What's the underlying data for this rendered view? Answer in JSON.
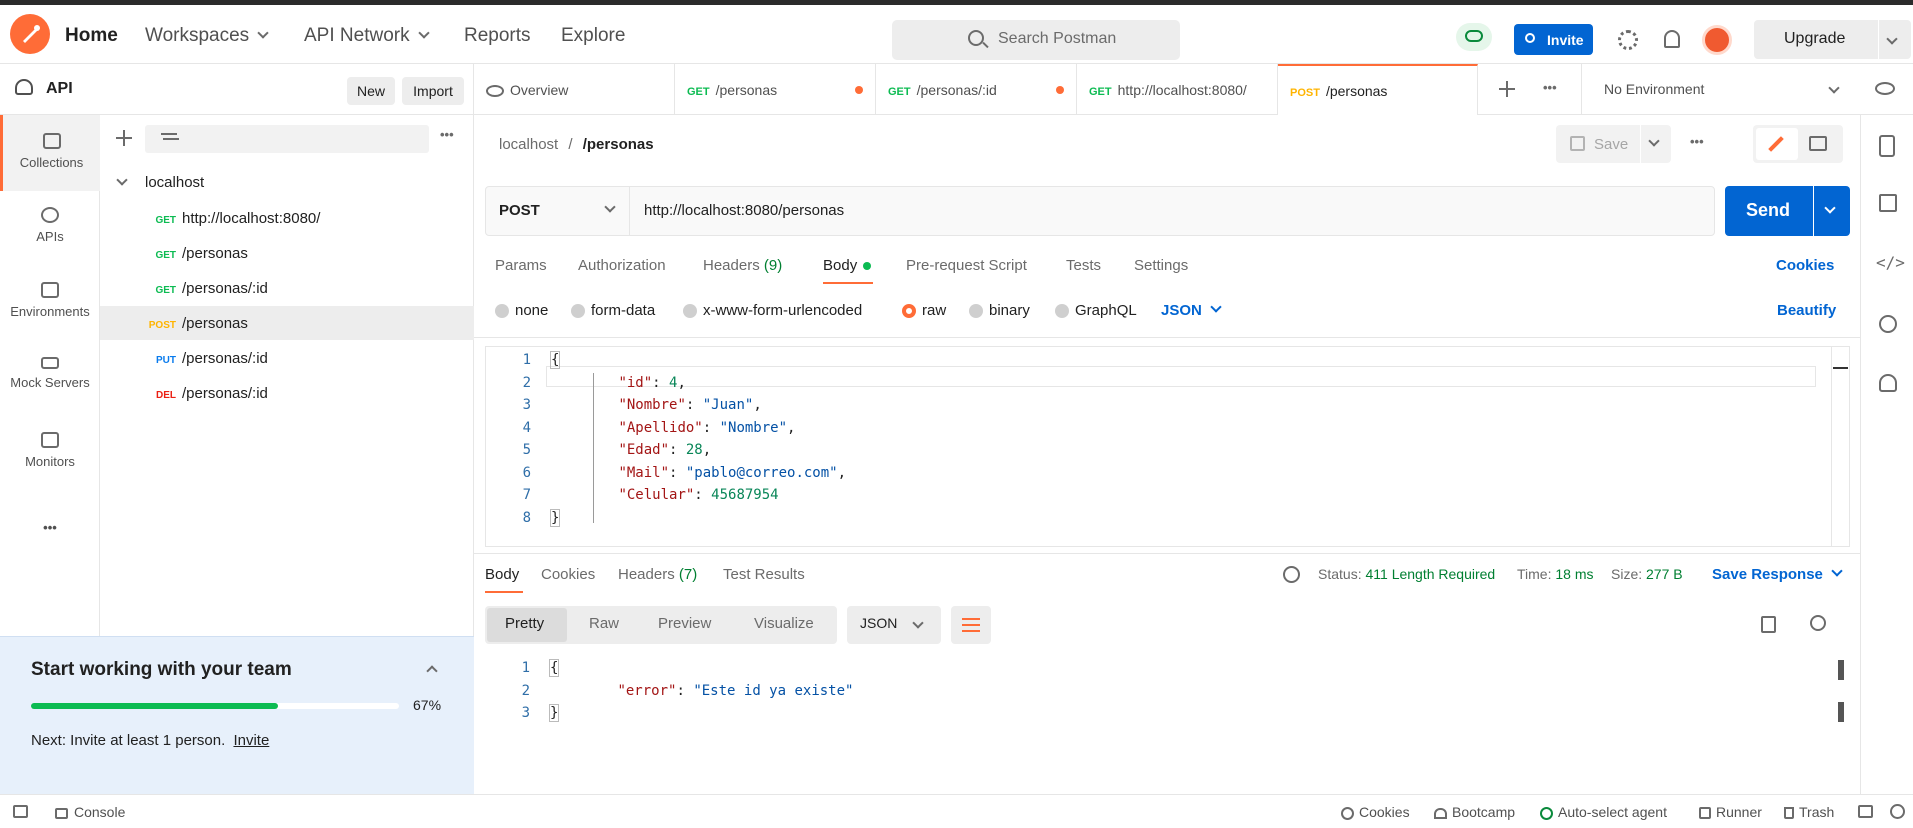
{
  "topnav": {
    "home": "Home",
    "workspaces": "Workspaces",
    "api_network": "API Network",
    "reports": "Reports",
    "explore": "Explore",
    "search_placeholder": "Search Postman",
    "invite": "Invite",
    "upgrade": "Upgrade"
  },
  "workspace": {
    "name": "API",
    "new_label": "New",
    "import_label": "Import"
  },
  "sidebar": {
    "items": [
      {
        "label": "Collections",
        "icon": "collections-icon"
      },
      {
        "label": "APIs",
        "icon": "apis-icon"
      },
      {
        "label": "Environments",
        "icon": "environments-icon"
      },
      {
        "label": "Mock Servers",
        "icon": "mock-servers-icon"
      },
      {
        "label": "Monitors",
        "icon": "monitors-icon"
      }
    ],
    "more": "•••"
  },
  "collection": {
    "name": "localhost",
    "requests": [
      {
        "method": "GET",
        "name": "http://localhost:8080/"
      },
      {
        "method": "GET",
        "name": "/personas"
      },
      {
        "method": "GET",
        "name": "/personas/:id"
      },
      {
        "method": "POST",
        "name": "/personas"
      },
      {
        "method": "PUT",
        "name": "/personas/:id"
      },
      {
        "method": "DEL",
        "name": "/personas/:id"
      }
    ]
  },
  "tabs": [
    {
      "method": "",
      "label": "Overview"
    },
    {
      "method": "GET",
      "label": "/personas"
    },
    {
      "method": "GET",
      "label": "/personas/:id"
    },
    {
      "method": "GET",
      "label": "http://localhost:8080/"
    },
    {
      "method": "POST",
      "label": "/personas"
    }
  ],
  "environment": "No Environment",
  "breadcrumb": {
    "parent": "localhost",
    "sep": "/",
    "current": "/personas"
  },
  "save_label": "Save",
  "request": {
    "method": "POST",
    "url": "http://localhost:8080/personas",
    "send": "Send"
  },
  "request_tabs": {
    "params": "Params",
    "authorization": "Authorization",
    "headers": "Headers",
    "headers_count": "(9)",
    "body": "Body",
    "prerequest": "Pre-request Script",
    "tests": "Tests",
    "settings": "Settings",
    "cookies": "Cookies"
  },
  "body_options": {
    "none": "none",
    "form_data": "form-data",
    "urlencoded": "x-www-form-urlencoded",
    "raw": "raw",
    "binary": "binary",
    "graphql": "GraphQL",
    "format": "JSON",
    "beautify": "Beautify"
  },
  "request_body": [
    {
      "n": "1",
      "t": "{"
    },
    {
      "n": "2",
      "key": "\"id\"",
      "val": "4",
      "vt": "n",
      "comma": ","
    },
    {
      "n": "3",
      "key": "\"Nombre\"",
      "val": "\"Juan\"",
      "vt": "s",
      "comma": ","
    },
    {
      "n": "4",
      "key": "\"Apellido\"",
      "val": "\"Nombre\"",
      "vt": "s",
      "comma": ","
    },
    {
      "n": "5",
      "key": "\"Edad\"",
      "val": "28",
      "vt": "n",
      "comma": ","
    },
    {
      "n": "6",
      "key": "\"Mail\"",
      "val": "\"pablo@correo.com\"",
      "vt": "s",
      "comma": ","
    },
    {
      "n": "7",
      "key": "\"Celular\"",
      "val": "45687954",
      "vt": "n",
      "comma": ""
    },
    {
      "n": "8",
      "t": "}"
    }
  ],
  "response_tabs": {
    "body": "Body",
    "cookies": "Cookies",
    "headers": "Headers",
    "headers_count": "(7)",
    "test_results": "Test Results"
  },
  "response_status": {
    "status_label": "Status:",
    "status_value": "411 Length Required",
    "time_label": "Time:",
    "time_value": "18 ms",
    "size_label": "Size:",
    "size_value": "277 B",
    "save_response": "Save Response"
  },
  "response_view": {
    "pretty": "Pretty",
    "raw": "Raw",
    "preview": "Preview",
    "visualize": "Visualize",
    "format": "JSON"
  },
  "response_body": [
    {
      "n": "1",
      "t": "{"
    },
    {
      "n": "2",
      "key": "\"error\"",
      "val": "\"Este id ya existe\"",
      "vt": "s",
      "comma": ""
    },
    {
      "n": "3",
      "t": "}"
    }
  ],
  "team_card": {
    "title": "Start working with your team",
    "progress_percent": 67,
    "progress_label": "67%",
    "next_text": "Next: Invite at least 1 person.",
    "invite_link": "Invite"
  },
  "statusbar": {
    "console": "Console",
    "cookies": "Cookies",
    "bootcamp": "Bootcamp",
    "auto_select": "Auto-select agent",
    "runner": "Runner",
    "trash": "Trash"
  }
}
